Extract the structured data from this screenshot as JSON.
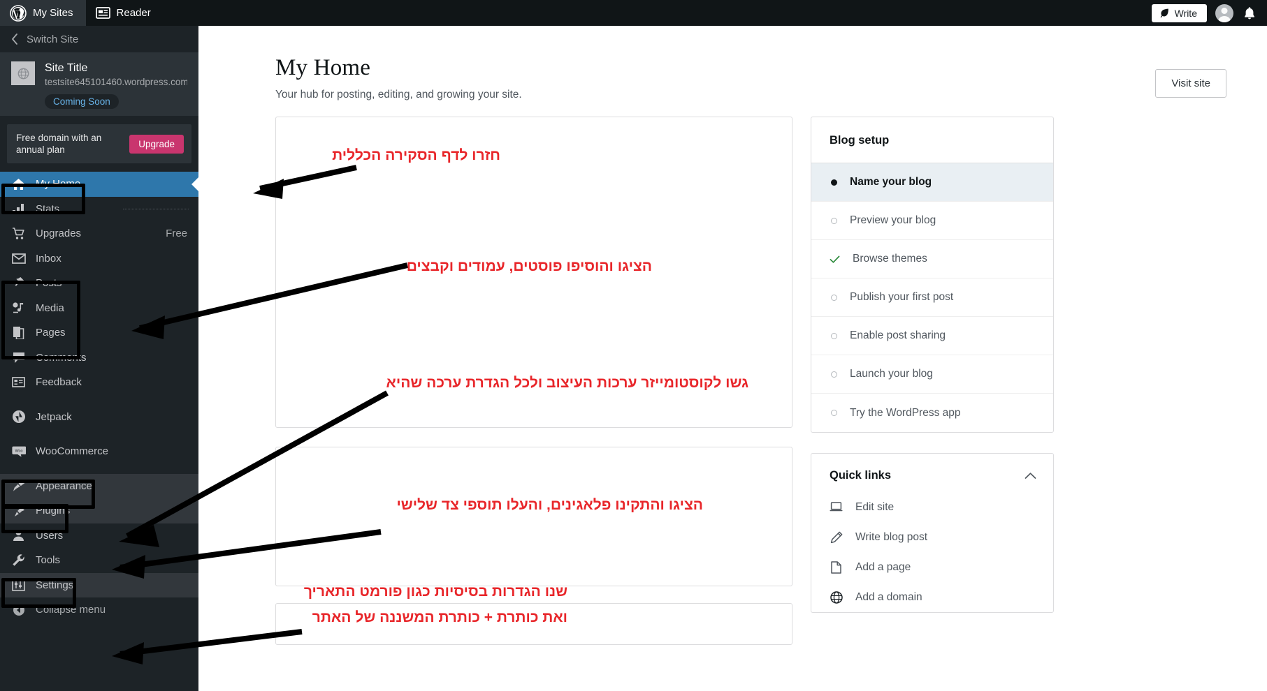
{
  "masthead": {
    "my_sites_label": "My Sites",
    "reader_label": "Reader",
    "write_label": "Write"
  },
  "sidebar": {
    "switch_site_label": "Switch Site",
    "site": {
      "title": "Site Title",
      "url": "testsite645101460.wordpress.com",
      "status_badge": "Coming Soon"
    },
    "upgrade_banner": {
      "text": "Free domain with an annual plan",
      "button_label": "Upgrade"
    },
    "items": [
      {
        "label": "My Home",
        "icon": "home-icon",
        "selected": true,
        "badge": ""
      },
      {
        "label": "Stats",
        "icon": "bar-chart-icon",
        "selected": false,
        "badge": ""
      },
      {
        "label": "Upgrades",
        "icon": "cart-icon",
        "selected": false,
        "badge": "Free"
      },
      {
        "label": "Inbox",
        "icon": "envelope-icon",
        "selected": false,
        "badge": ""
      },
      {
        "label": "Posts",
        "icon": "pin-icon",
        "selected": false,
        "badge": ""
      },
      {
        "label": "Media",
        "icon": "media-icon",
        "selected": false,
        "badge": ""
      },
      {
        "label": "Pages",
        "icon": "pages-icon",
        "selected": false,
        "badge": ""
      },
      {
        "label": "Comments",
        "icon": "comment-icon",
        "selected": false,
        "badge": ""
      },
      {
        "label": "Feedback",
        "icon": "feedback-icon",
        "selected": false,
        "badge": ""
      },
      {
        "label": "Jetpack",
        "icon": "jetpack-icon",
        "selected": false,
        "badge": ""
      },
      {
        "label": "WooCommerce",
        "icon": "woocommerce-icon",
        "selected": false,
        "badge": ""
      },
      {
        "label": "Appearance",
        "icon": "brush-icon",
        "selected": false,
        "badge": ""
      },
      {
        "label": "Plugins",
        "icon": "plug-icon",
        "selected": false,
        "badge": ""
      },
      {
        "label": "Users",
        "icon": "user-icon",
        "selected": false,
        "badge": ""
      },
      {
        "label": "Tools",
        "icon": "wrench-icon",
        "selected": false,
        "badge": ""
      },
      {
        "label": "Settings",
        "icon": "sliders-icon",
        "selected": false,
        "badge": ""
      }
    ],
    "collapse_label": "Collapse menu"
  },
  "main": {
    "title": "My Home",
    "subtitle": "Your hub for posting, editing, and growing your site.",
    "visit_site_label": "Visit site"
  },
  "blog_setup": {
    "title": "Blog setup",
    "items": [
      {
        "label": "Name your blog",
        "state": "current"
      },
      {
        "label": "Preview your blog",
        "state": "todo"
      },
      {
        "label": "Browse themes",
        "state": "done"
      },
      {
        "label": "Publish your first post",
        "state": "todo"
      },
      {
        "label": "Enable post sharing",
        "state": "todo"
      },
      {
        "label": "Launch your blog",
        "state": "todo"
      },
      {
        "label": "Try the WordPress app",
        "state": "todo"
      }
    ]
  },
  "quick_links": {
    "title": "Quick links",
    "items": [
      {
        "label": "Edit site",
        "icon": "laptop-icon"
      },
      {
        "label": "Write blog post",
        "icon": "pencil-icon"
      },
      {
        "label": "Add a page",
        "icon": "page-icon"
      },
      {
        "label": "Add a domain",
        "icon": "globe-icon"
      }
    ]
  },
  "annotations": {
    "colors": {
      "text": "#e8262a",
      "box": "#000000"
    },
    "notes": [
      {
        "id": "note-overview",
        "text": "חזרו לדף הסקירה הכללית"
      },
      {
        "id": "note-posts",
        "text": "הציגו והוסיפו פוסטים, עמודים וקבצים"
      },
      {
        "id": "note-appearance",
        "text": "גשו לקוסטומייזר ערכות העיצוב ולכל הגדרת ערכה שהיא"
      },
      {
        "id": "note-plugins",
        "text": "הציגו והתקינו פלאגינים, והעלו תוספי צד שלישי"
      },
      {
        "id": "note-settings-1",
        "text": "שנו הגדרות בסיסיות כגון פורמט התאריך"
      },
      {
        "id": "note-settings-2",
        "text": "ואת כותרת + כותרת המשננה של האתר"
      }
    ]
  }
}
